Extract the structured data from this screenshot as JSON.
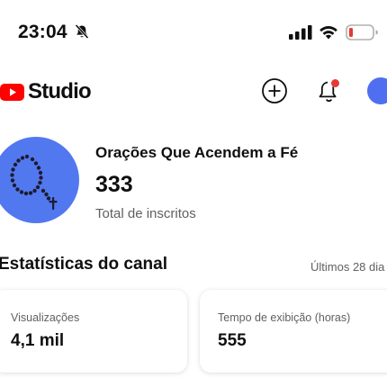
{
  "status_bar": {
    "time": "23:04",
    "icons": [
      "bell-slash-icon",
      "signal-icon",
      "wifi-icon",
      "battery-low-icon"
    ],
    "battery_color": "#e53935"
  },
  "header": {
    "logo_text": "Studio",
    "logo_icon": "youtube-play-icon",
    "brand_color": "#ff0000",
    "actions": [
      "create-icon",
      "notifications-icon"
    ],
    "notification_dot_color": "#e53935"
  },
  "channel": {
    "name": "Orações Que Acendem a Fé",
    "subscribers": "333",
    "subscribers_label": "Total de inscritos",
    "avatar_color": "#5278f0"
  },
  "stats": {
    "title": "Estatísticas do canal",
    "period": "Últimos 28 dia",
    "cards": [
      {
        "label": "Visualizações",
        "value": "4,1 mil"
      },
      {
        "label": "Tempo de exibição (horas)",
        "value": "555"
      }
    ]
  }
}
